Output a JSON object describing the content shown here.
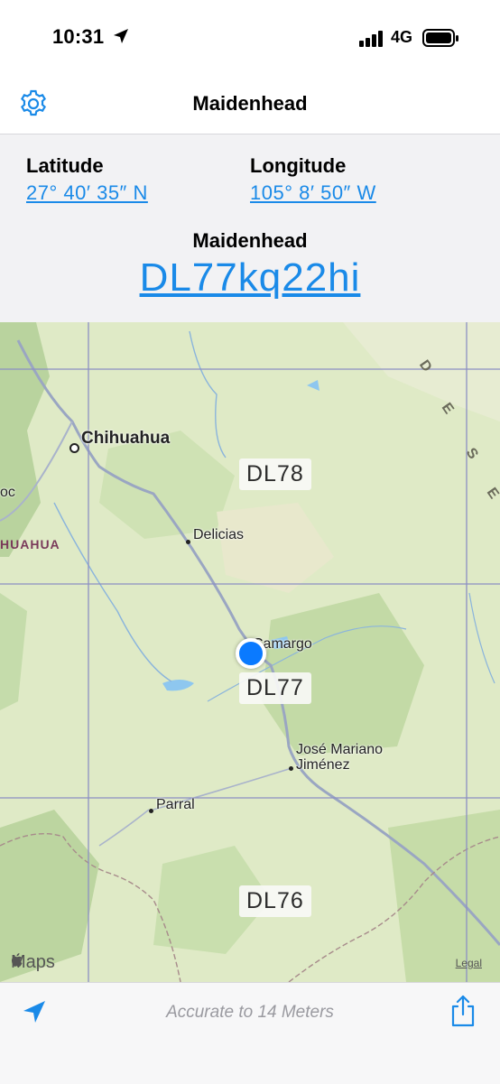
{
  "status": {
    "time": "10:31",
    "network": "4G"
  },
  "nav": {
    "title": "Maidenhead",
    "settings_icon": "gear-icon"
  },
  "info": {
    "latitude_label": "Latitude",
    "latitude_value": "27° 40′ 35″ N",
    "longitude_label": "Longitude",
    "longitude_value": "105° 8′ 50″ W",
    "maidenhead_label": "Maidenhead",
    "maidenhead_value": "DL77kq22hi"
  },
  "map": {
    "cities": {
      "chihuahua": "Chihuahua",
      "delicias": "Delicias",
      "camargo": "Camargo",
      "jose_mariano_1": "José Mariano",
      "jose_mariano_2": "Jiménez",
      "parral": "Parral",
      "partial_left": "oc"
    },
    "region_label": "HUAHUA",
    "desert_letters": [
      "D",
      "E",
      "S",
      "E"
    ],
    "grid_labels": {
      "dl78": "DL78",
      "dl77": "DL77",
      "dl76": "DL76"
    },
    "attribution": "Maps",
    "legal": "Legal"
  },
  "toolbar": {
    "accuracy_text": "Accurate to 14 Meters",
    "location_icon": "location-arrow-icon",
    "share_icon": "share-icon"
  },
  "colors": {
    "accent": "#1a8ae8",
    "user_location": "#0a7aff",
    "map_base": "#dfeac6",
    "grid_lines": "#8c8fc4"
  }
}
